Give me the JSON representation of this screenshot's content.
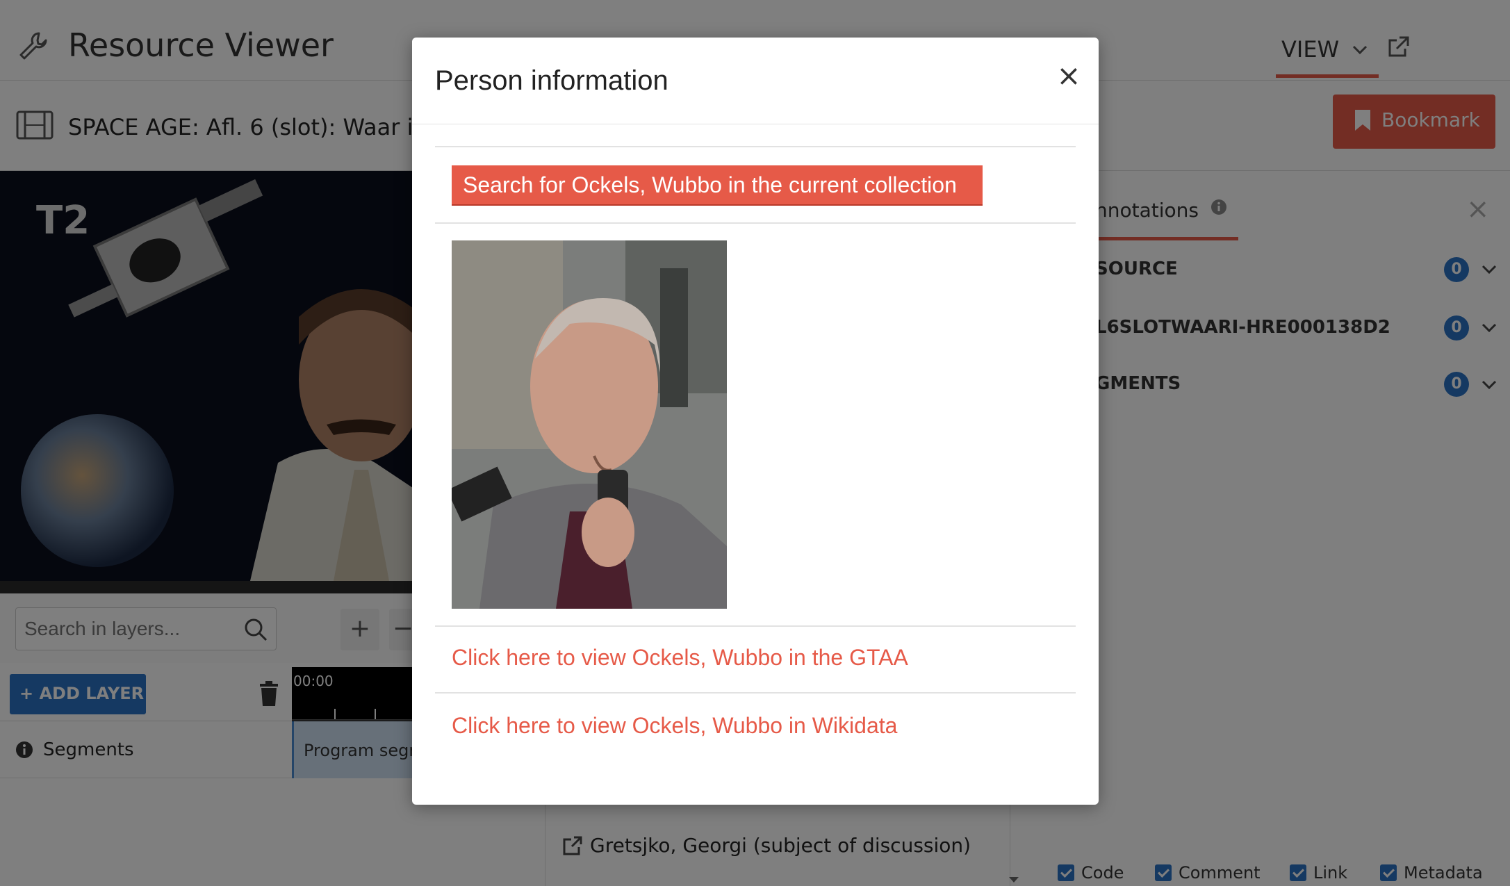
{
  "app": {
    "title": "Resource Viewer",
    "view_menu_label": "VIEW",
    "resource_title": "SPACE AGE: Afl. 6 (slot): Waar i",
    "bookmark_label": "Bookmark"
  },
  "layers": {
    "search_placeholder": "Search in layers...",
    "plus_label": "+",
    "minus_label": "−",
    "add_layer_label": "ADD LAYER",
    "add_layer_prefix": "+",
    "timeline_time": "00:00",
    "segments_label": "Segments",
    "program_segment_label": "Program segm"
  },
  "middle_panel": {
    "item": "Gretsjko, Georgi (subject of discussion)"
  },
  "annotations": {
    "tab_label": "nnotations",
    "close_label": "×",
    "rows": [
      {
        "label": "SOURCE",
        "count": "0"
      },
      {
        "label": "L6SLOTWAARI-HRE000138D2",
        "count": "0"
      },
      {
        "label": "GMENTS",
        "count": "0"
      }
    ],
    "filters": [
      {
        "label": "Code",
        "checked": true
      },
      {
        "label": "Comment",
        "checked": true
      },
      {
        "label": "Link",
        "checked": true
      },
      {
        "label": "Metadata",
        "checked": true
      }
    ]
  },
  "modal": {
    "title": "Person information",
    "close_label": "×",
    "search_button": "Search for Ockels, Wubbo in the current collection",
    "gtaa_link": "Click here to view Ockels, Wubbo in the GTAA",
    "wikidata_link": "Click here to view Ockels, Wubbo in Wikidata"
  },
  "colors": {
    "accent": "#e65a48",
    "primary_blue": "#2a72c4",
    "overlay": "rgba(0,0,0,0.5)"
  },
  "icons": [
    "wrench-icon",
    "chevron-down-icon",
    "external-link-icon",
    "film-icon",
    "bookmark-icon",
    "search-icon",
    "trash-icon",
    "info-icon",
    "close-icon"
  ]
}
